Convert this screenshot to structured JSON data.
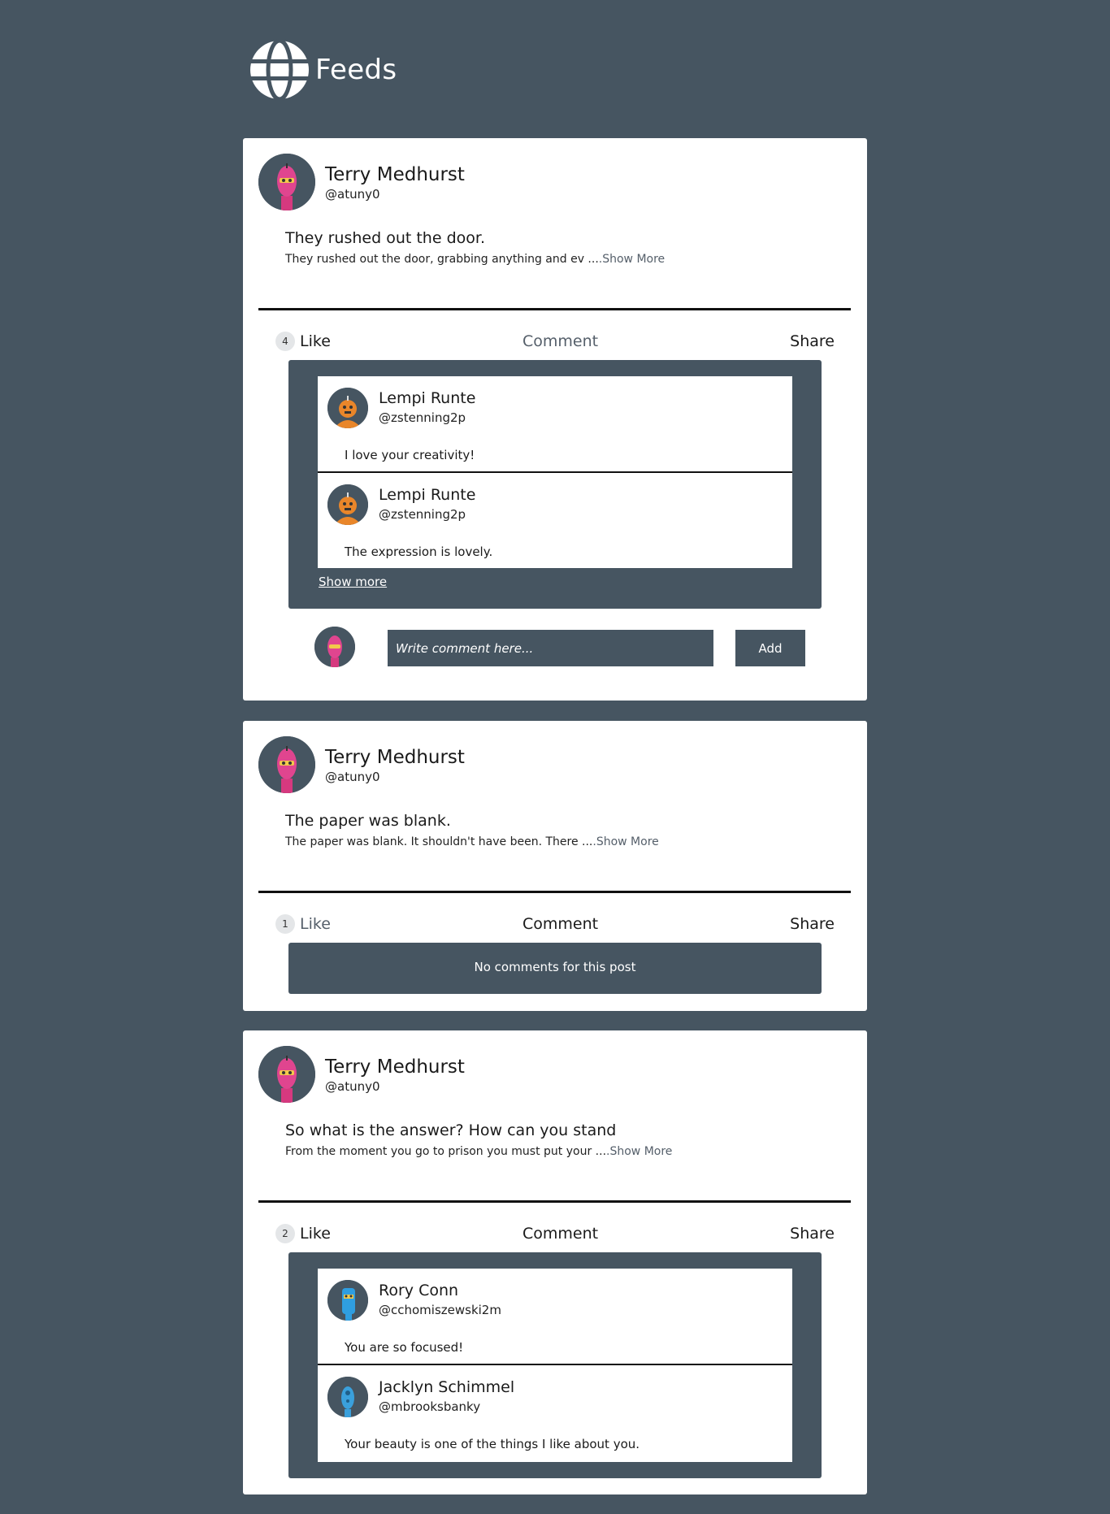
{
  "app": {
    "title": "Feeds",
    "icon": "globe-icon"
  },
  "colors": {
    "background": "#465561",
    "card": "#ffffff",
    "divider": "#111111"
  },
  "posts": [
    {
      "author": {
        "name": "Terry Medhurst",
        "handle": "@atuny0",
        "avatar": "pink-robot-avatar"
      },
      "title": "They rushed out the door.",
      "body": "They rushed out the door, grabbing anything and ev ...",
      "show_more": ".Show More",
      "likes": "4",
      "like_label": "Like",
      "comment_label": "Comment",
      "share_label": "Share",
      "comments": [
        {
          "name": "Lempi Runte",
          "handle": "@zstenning2p",
          "text": "I love your creativity!",
          "avatar": "orange-robot-avatar"
        },
        {
          "name": "Lempi Runte",
          "handle": "@zstenning2p",
          "text": "The expression is lovely.",
          "avatar": "orange-robot-avatar"
        }
      ],
      "show_more_comments": "Show more",
      "composer": {
        "placeholder": "Write comment here...",
        "add_label": "Add"
      }
    },
    {
      "author": {
        "name": "Terry Medhurst",
        "handle": "@atuny0",
        "avatar": "pink-robot-avatar"
      },
      "title": "The paper was blank.",
      "body": "The paper was blank. It shouldn't have been. There ...",
      "show_more": ".Show More",
      "likes": "1",
      "like_label": "Like",
      "comment_label": "Comment",
      "share_label": "Share",
      "no_comments": "No comments for this post"
    },
    {
      "author": {
        "name": "Terry Medhurst",
        "handle": "@atuny0",
        "avatar": "pink-robot-avatar"
      },
      "title": "So what is the answer? How can you stand",
      "body": "From the moment you go to prison you must put your ...",
      "show_more": ".Show More",
      "likes": "2",
      "like_label": "Like",
      "comment_label": "Comment",
      "share_label": "Share",
      "comments": [
        {
          "name": "Rory Conn",
          "handle": "@cchomiszewski2m",
          "text": "You are so focused!",
          "avatar": "blue-robot-avatar"
        },
        {
          "name": "Jacklyn Schimmel",
          "handle": "@mbrooksbanky",
          "text": "Your beauty is one of the things I like about you.",
          "avatar": "blue-robot-avatar"
        }
      ]
    }
  ]
}
